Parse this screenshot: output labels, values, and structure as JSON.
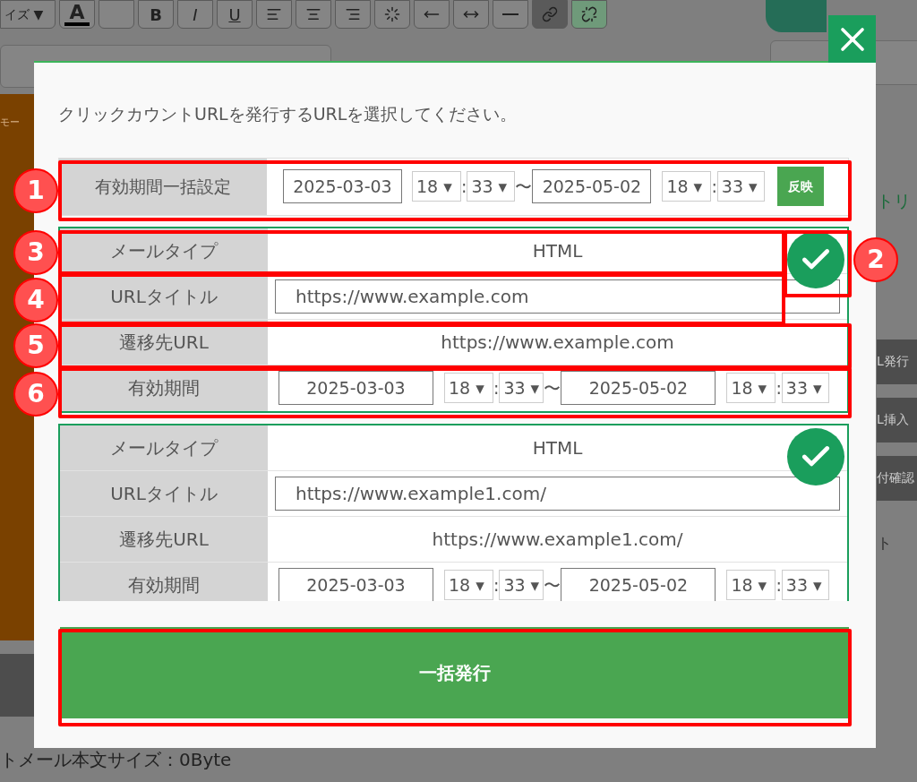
{
  "background": {
    "toolbar": [
      {
        "kind": "select",
        "label": "イズ ▼"
      },
      {
        "kind": "text-color",
        "label": "A"
      },
      {
        "kind": "color"
      },
      {
        "kind": "bold",
        "label": "B"
      },
      {
        "kind": "italic",
        "label": "I"
      },
      {
        "kind": "underline",
        "label": "U"
      },
      {
        "kind": "align-left"
      },
      {
        "kind": "align-center"
      },
      {
        "kind": "align-right"
      },
      {
        "kind": "loading"
      },
      {
        "kind": "arrow-left"
      },
      {
        "kind": "arrow-both"
      },
      {
        "kind": "rule"
      },
      {
        "kind": "link",
        "selected": true
      },
      {
        "kind": "unlink",
        "selected": false
      }
    ],
    "left_label": "モー",
    "right_items": [
      {
        "kind": "link",
        "text": "トリ"
      },
      {
        "kind": "button",
        "text": "L発行"
      },
      {
        "kind": "button",
        "text": "L挿入"
      },
      {
        "kind": "button",
        "text": "付確認"
      },
      {
        "kind": "text",
        "text": "ト"
      }
    ],
    "footer_text": "トメール本文サイズ：0Byte"
  },
  "modal": {
    "instruction": "クリックカウントURLを発行するURLを選択してください。",
    "bulk": {
      "label": "有効期間一括設定",
      "start_date": "2025-03-03",
      "start_hour": "18 ▾",
      "colon_1": ":",
      "start_minute": "33 ▾",
      "separator": "〜",
      "end_date": "2025-05-02",
      "end_hour": "18 ▾",
      "colon_2": ":",
      "end_minute": "33 ▾",
      "apply_button": "反映"
    },
    "entries": [
      {
        "checked": true,
        "rows": [
          {
            "kind": "text",
            "label": "メールタイプ",
            "value": "HTML"
          },
          {
            "kind": "input",
            "label": "URLタイトル",
            "value": "https://www.example.com"
          },
          {
            "kind": "text",
            "label": "遷移先URL",
            "value": "https://www.example.com"
          },
          {
            "kind": "period",
            "label": "有効期間",
            "start_date": "2025-03-03",
            "start_hour": "18 ▾",
            "colon_1": ":",
            "start_minute": "33 ▾",
            "separator": "〜",
            "end_date": "2025-05-02",
            "end_hour": "18 ▾",
            "colon_2": ":",
            "end_minute": "33 ▾"
          }
        ]
      },
      {
        "checked": true,
        "rows": [
          {
            "kind": "text",
            "label": "メールタイプ",
            "value": "HTML"
          },
          {
            "kind": "input",
            "label": "URLタイトル",
            "value": "https://www.example1.com/"
          },
          {
            "kind": "text",
            "label": "遷移先URL",
            "value": "https://www.example1.com/"
          },
          {
            "kind": "period",
            "label": "有効期間",
            "start_date": "2025-03-03",
            "start_hour": "18 ▾",
            "colon_1": ":",
            "start_minute": "33 ▾",
            "separator": "〜",
            "end_date": "2025-05-02",
            "end_hour": "18 ▾",
            "colon_2": ":",
            "end_minute": "33 ▾"
          }
        ]
      }
    ],
    "submit_button": "一括発行",
    "submit_highlighted": true
  },
  "annotations": [
    {
      "number": "1"
    },
    {
      "number": "3"
    },
    {
      "number": "4"
    },
    {
      "number": "5"
    },
    {
      "number": "6"
    },
    {
      "number": "2"
    }
  ]
}
